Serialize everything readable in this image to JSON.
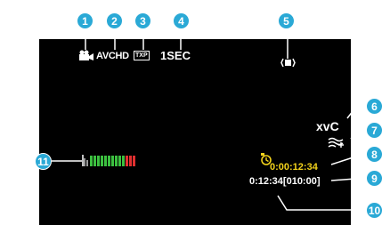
{
  "callouts": [
    "1",
    "2",
    "3",
    "4",
    "5",
    "6",
    "7",
    "8",
    "9",
    "10",
    "11"
  ],
  "osd": {
    "video_mode_icon": "video-camera-icon",
    "format": "AVCHD",
    "quality": "TXP",
    "interval": "1SEC",
    "stabilizer_icon": "image-stabilizer-icon",
    "color_mode": "xvC",
    "wind_cut_icon": "wind-cut-icon",
    "time_lapse_icon": "time-lapse-icon",
    "time_lapse_counter": "0:00:12:34",
    "remaining": "0:12:34[010:00]",
    "audio_meter_label": "audio-level-meter-icon"
  },
  "meter": {
    "green_bars": 10,
    "red_bars": 3,
    "green_color": "#3cc040",
    "red_color": "#e03030"
  },
  "colors": {
    "callout": "#2aa9d6",
    "screen": "#000000",
    "timer": "#f2d21b"
  }
}
